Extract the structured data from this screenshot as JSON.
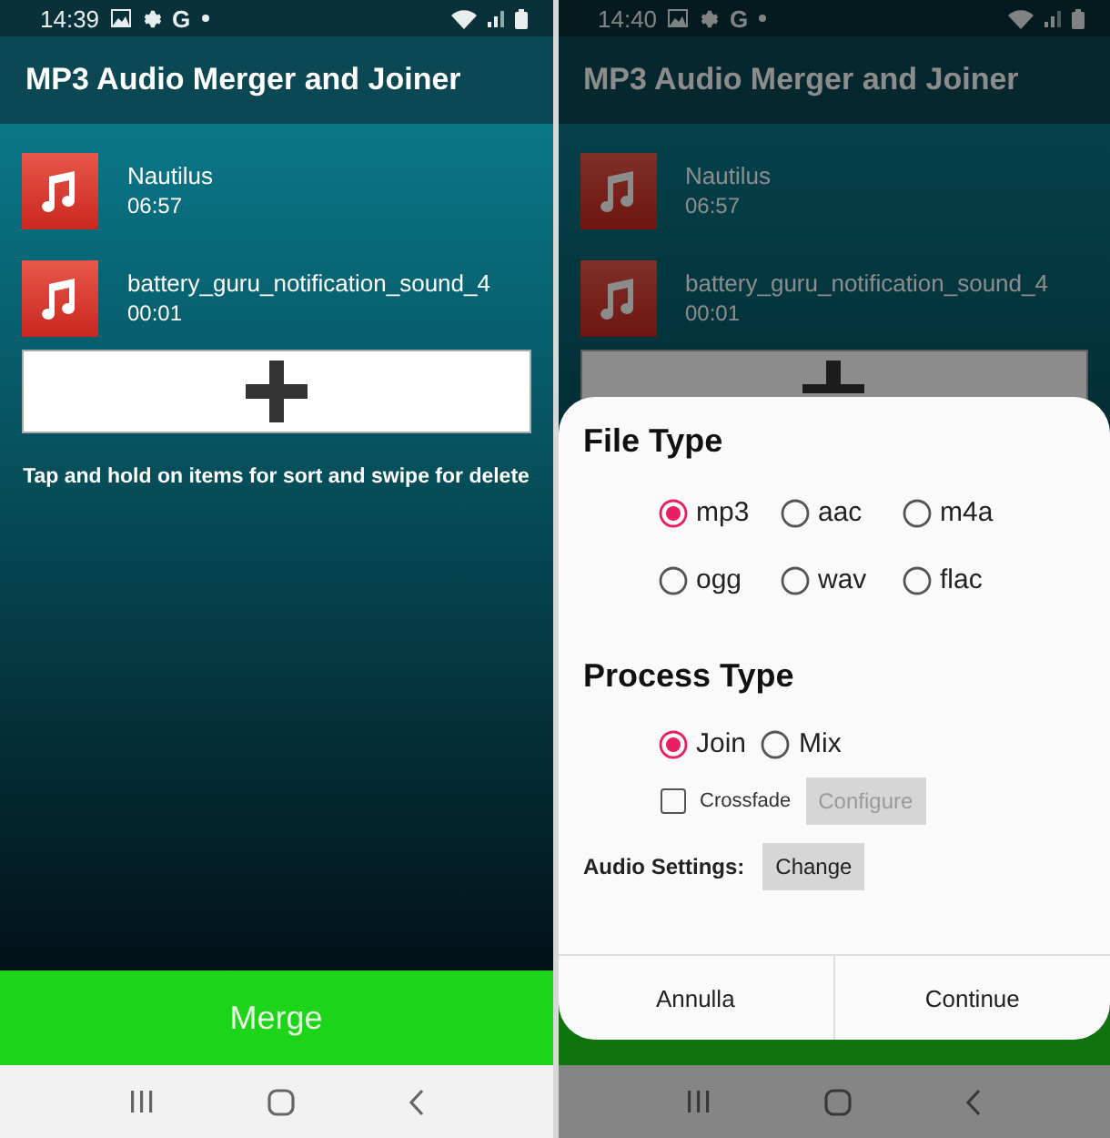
{
  "screens": [
    {
      "status_bar": {
        "time": "14:39",
        "letter": "G"
      },
      "app_title": "MP3 Audio Merger and Joiner",
      "tracks": [
        {
          "name": "Nautilus",
          "duration": "06:57"
        },
        {
          "name": "battery_guru_notification_sound_4",
          "duration": "00:01"
        }
      ],
      "hint": "Tap and hold on items for sort and swipe for delete",
      "merge_button": "Merge"
    },
    {
      "status_bar": {
        "time": "14:40",
        "letter": "G"
      },
      "app_title": "MP3 Audio Merger and Joiner",
      "dimmed": true,
      "tracks": [
        {
          "name": "Nautilus",
          "duration": "06:57"
        },
        {
          "name": "battery_guru_notification_sound_4",
          "duration": "00:01"
        }
      ],
      "dialog": {
        "file_type_title": "File Type",
        "file_types": [
          {
            "label": "mp3",
            "selected": true
          },
          {
            "label": "aac",
            "selected": false
          },
          {
            "label": "m4a",
            "selected": false
          },
          {
            "label": "ogg",
            "selected": false
          },
          {
            "label": "wav",
            "selected": false
          },
          {
            "label": "flac",
            "selected": false
          }
        ],
        "process_type_title": "Process Type",
        "process_types": [
          {
            "label": "Join",
            "selected": true
          },
          {
            "label": "Mix",
            "selected": false
          }
        ],
        "crossfade": {
          "label": "Crossfade",
          "checked": false
        },
        "configure_button": {
          "label": "Configure",
          "disabled": true
        },
        "audio_settings_label": "Audio Settings:",
        "change_button": "Change",
        "buttons": [
          "Annulla",
          "Continue"
        ]
      }
    }
  ]
}
